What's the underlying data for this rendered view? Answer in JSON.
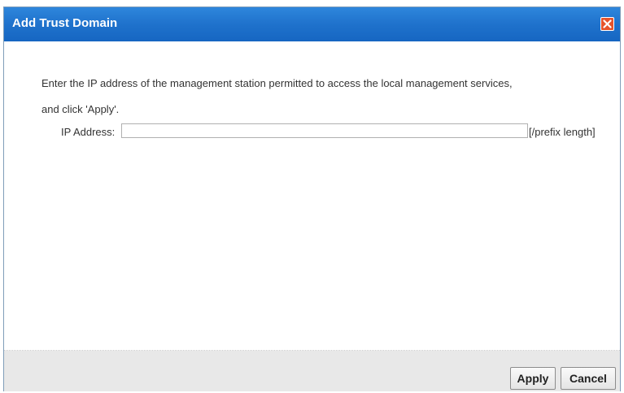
{
  "dialog": {
    "title": "Add Trust Domain",
    "close_icon": "close-x-icon"
  },
  "content": {
    "description_line1": "Enter the IP address of the management station permitted to access the local management services,",
    "description_line2": "and click 'Apply'.",
    "ip_label": "IP Address:",
    "ip_value": "",
    "ip_placeholder": "",
    "prefix_note": "[/prefix length]"
  },
  "footer": {
    "apply_label": "Apply",
    "cancel_label": "Cancel"
  },
  "colors": {
    "titlebar": "#1f72cc",
    "close_button": "#e6532c",
    "footer_bg": "#e8e8e8"
  }
}
